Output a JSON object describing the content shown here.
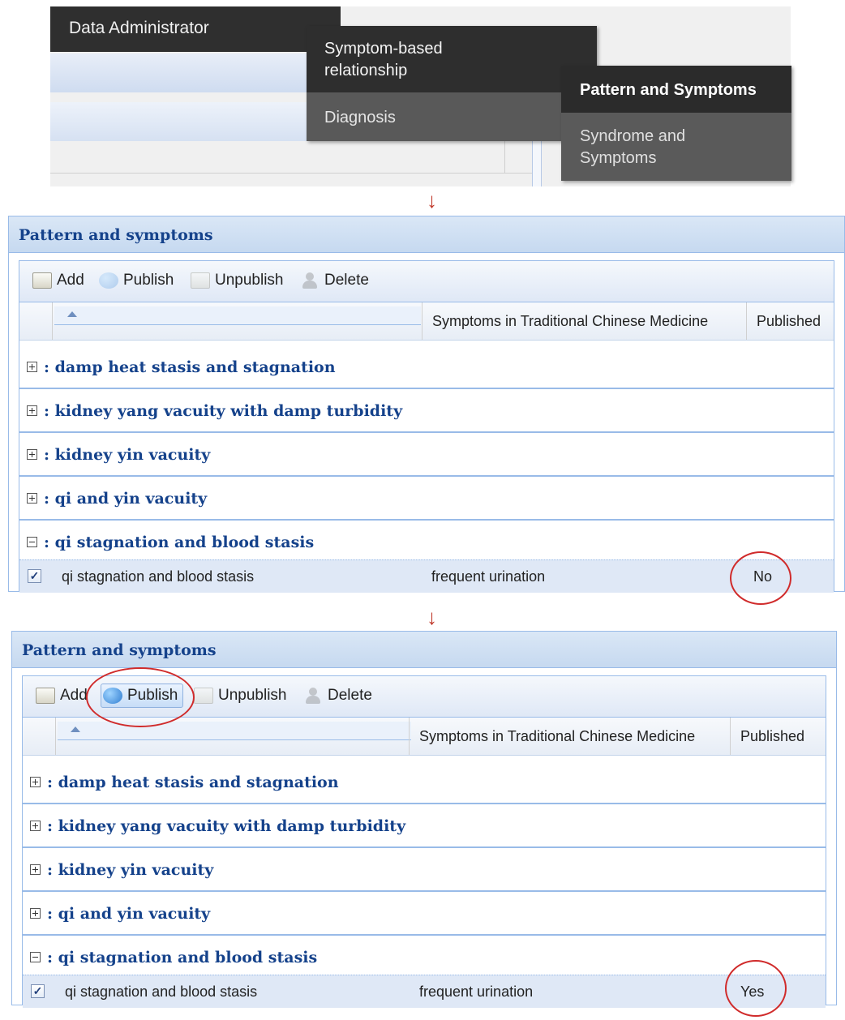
{
  "menu": {
    "level1": "Data Administrator",
    "level2_top": "Symptom-based relationship",
    "level2_bottom": "Diagnosis",
    "level3_top": "Pattern and Symptoms",
    "level3_bottom": "Syndrome and Symptoms"
  },
  "arrows": [
    "↓",
    "↓"
  ],
  "panel1": {
    "title": "Pattern and symptoms",
    "toolbar": {
      "add": "Add",
      "publish": "Publish",
      "unpublish": "Unpublish",
      "delete": "Delete"
    },
    "columns": {
      "symptoms": "Symptoms in Traditional Chinese Medicine",
      "published": "Published"
    },
    "groups": [
      ": damp heat stasis and stagnation",
      ": kidney yang vacuity with damp turbidity",
      ": kidney yin vacuity",
      ": qi and yin vacuity",
      ": qi stagnation and blood stasis"
    ],
    "row": {
      "pattern": "qi stagnation and blood stasis",
      "symptom": "frequent urination",
      "published": "No",
      "checked": "✓"
    }
  },
  "panel2": {
    "title": "Pattern and symptoms",
    "toolbar": {
      "add": "Add",
      "publish": "Publish",
      "unpublish": "Unpublish",
      "delete": "Delete"
    },
    "columns": {
      "symptoms": "Symptoms in Traditional Chinese Medicine",
      "published": "Published"
    },
    "groups": [
      ": damp heat stasis and stagnation",
      ": kidney yang vacuity with damp turbidity",
      ": kidney yin vacuity",
      ": qi and yin vacuity",
      ": qi stagnation and blood stasis"
    ],
    "row": {
      "pattern": "qi stagnation and blood stasis",
      "symptom": "frequent urination",
      "published": "Yes",
      "checked": "✓"
    }
  }
}
